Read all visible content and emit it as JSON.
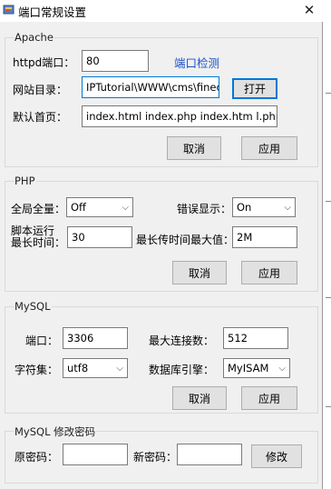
{
  "window": {
    "title": "端口常规设置",
    "close_glyph": "✕"
  },
  "apache": {
    "legend": "Apache",
    "port_label": "httpd端口：",
    "port_value": "80",
    "port_check": "端口检测",
    "webroot_label": "网站目录：",
    "webroot_value": "IPTutorial\\WWW\\cms\\finecms",
    "open_label": "打开",
    "index_label": "默认首页：",
    "index_value": "index.html index.php index.htm l.php",
    "cancel": "取消",
    "apply": "应用"
  },
  "php": {
    "legend": "PHP",
    "globals_label": "全局全量：",
    "globals_value": "Off",
    "errors_label": "错误显示：",
    "errors_value": "On",
    "exec_label_1": "脚本运行",
    "exec_label_2": "最长时间：",
    "exec_value": "30",
    "upload_label": "最长传时间最大值：",
    "upload_value": "2M",
    "cancel": "取消",
    "apply": "应用"
  },
  "mysql": {
    "legend": "MySQL",
    "port_label": "端口：",
    "port_value": "3306",
    "maxconn_label": "最大连接数：",
    "maxconn_value": "512",
    "charset_label": "字符集：",
    "charset_value": "utf8",
    "engine_label": "数据库引擎：",
    "engine_value": "MyISAM",
    "cancel": "取消",
    "apply": "应用"
  },
  "password": {
    "legend": "MySQL 修改密码",
    "old_label": "原密码：",
    "old_value": "",
    "new_label": "新密码：",
    "new_value": "",
    "change": "修改"
  }
}
